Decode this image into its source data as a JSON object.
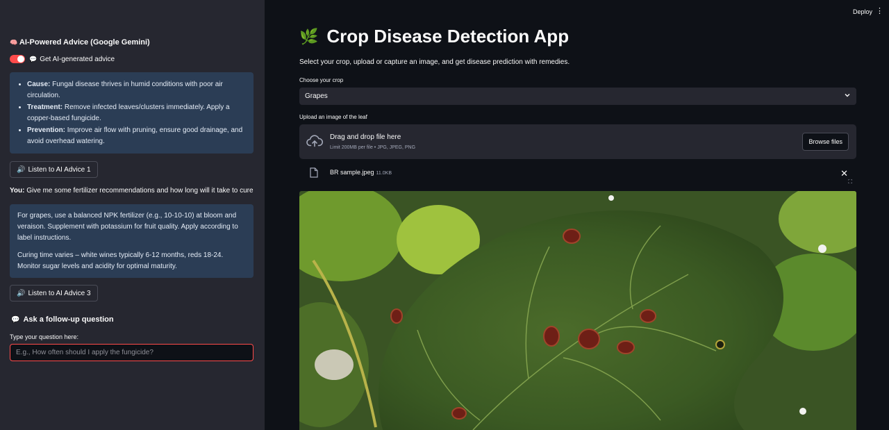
{
  "sidebar": {
    "title": "AI-Powered Advice (Google Gemini)",
    "toggle_label": "Get AI-generated advice",
    "advice1": [
      {
        "label": "Cause:",
        "text": "Fungal disease thrives in humid conditions with poor air circulation."
      },
      {
        "label": "Treatment:",
        "text": "Remove infected leaves/clusters immediately. Apply a copper-based fungicide."
      },
      {
        "label": "Prevention:",
        "text": "Improve air flow with pruning, ensure good drainage, and avoid overhead watering."
      }
    ],
    "listen1_label": "Listen to AI Advice 1",
    "you_label": "You:",
    "you_text": "Give me some fertilizer recommendations and how long will it take to cure",
    "answer_p1": "For grapes, use a balanced NPK fertilizer (e.g., 10-10-10) at bloom and veraison. Supplement with potassium for fruit quality. Apply according to label instructions.",
    "answer_p2": "Curing time varies – white wines typically 6-12 months, reds 18-24. Monitor sugar levels and acidity for optimal maturity.",
    "listen3_label": "Listen to AI Advice 3",
    "followup_title": "Ask a follow-up question",
    "question_label": "Type your question here:",
    "question_placeholder": "E.g., How often should I apply the fungicide?",
    "toggle_on": true
  },
  "header": {
    "deploy_label": "Deploy"
  },
  "main": {
    "title": "Crop Disease Detection App",
    "subtitle": "Select your crop, upload or capture an image, and get disease prediction with remedies.",
    "crop_label": "Choose your crop",
    "crop_value": "Grapes",
    "upload_label": "Upload an image of the leaf",
    "dropzone_title": "Drag and drop file here",
    "dropzone_limit": "Limit 200MB per file • JPG, JPEG, PNG",
    "browse_label": "Browse files",
    "file_name": "BR sample.jpeg",
    "file_size": "11.0KB"
  },
  "colors": {
    "accent": "#ff4b4b",
    "sidebar_bg": "#262730",
    "main_bg": "#0e1117",
    "info_bg": "#2b3d55"
  }
}
